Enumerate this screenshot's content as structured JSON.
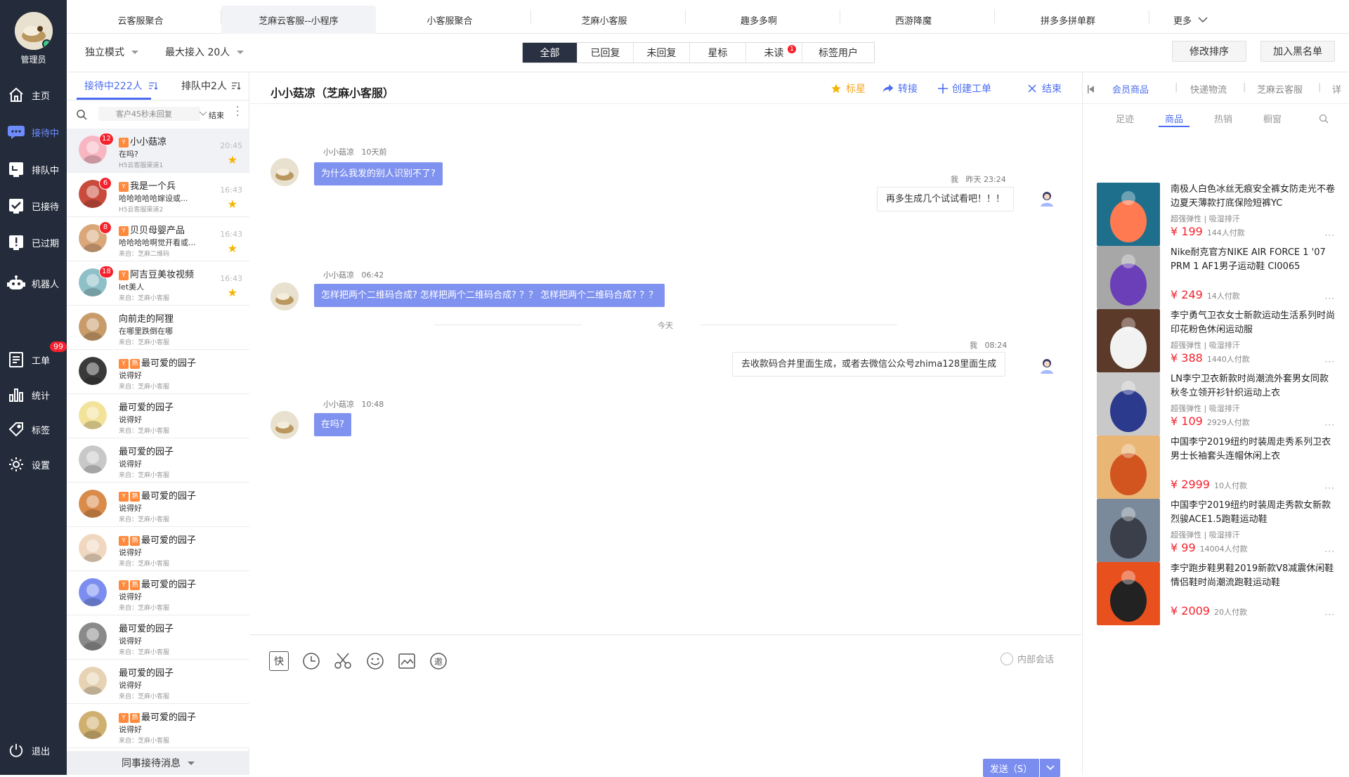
{
  "nav": {
    "role": "管理员",
    "items": [
      {
        "label": "主页",
        "icon": "home-icon"
      },
      {
        "label": "接待中",
        "icon": "chat-icon"
      },
      {
        "label": "排队中",
        "icon": "queue-icon"
      },
      {
        "label": "已接待",
        "icon": "check-icon"
      },
      {
        "label": "已过期",
        "icon": "alert-icon"
      },
      {
        "label": "机器人",
        "icon": "robot-icon"
      },
      {
        "label": "工单",
        "icon": "ticket-icon",
        "badge": "99"
      },
      {
        "label": "统计",
        "icon": "chart-icon"
      },
      {
        "label": "标签",
        "icon": "tag-icon"
      },
      {
        "label": "设置",
        "icon": "gear-icon"
      }
    ],
    "logout": "退出"
  },
  "top_tabs": [
    "云客服聚合",
    "芝麻云客服--小程序",
    "小客服聚合",
    "芝麻小客服",
    "趣多多啊",
    "西游降魔",
    "拼多多拼单群",
    "更多"
  ],
  "subbar": {
    "mode": "独立模式",
    "max_access": "最大接入 20人",
    "filters": [
      "全部",
      "已回复",
      "未回复",
      "星标",
      "未读",
      "标签用户"
    ],
    "unread_count": "1",
    "sort_button": "修改排序",
    "blacklist_button": "加入黑名单"
  },
  "list": {
    "tab_serving": "接待中222人",
    "tab_queue": "排队中2人",
    "search_placeholder": "客户45秒未回复",
    "end_label": "结束",
    "footer": "同事接待消息",
    "conversations": [
      {
        "name": "小小菇凉",
        "msg": "在吗?",
        "src": "H5云客服渠道1",
        "time": "20:45",
        "badge": "12",
        "tags": [
          "Y"
        ],
        "star": true
      },
      {
        "name": "我是一个兵",
        "msg": "哈哈哈哈哈嫁设或...",
        "src": "H5云客服渠道2",
        "time": "16:43",
        "badge": "6",
        "tags": [
          "Y"
        ],
        "star": true
      },
      {
        "name": "贝贝母婴产品",
        "msg": "哈哈哈哈啊觉开看或...",
        "src": "来自：芝麻二维码",
        "time": "16:43",
        "badge": "8",
        "tags": [
          "Y"
        ],
        "star": true
      },
      {
        "name": "阿吉豆美妆视频",
        "msg": "let美人",
        "src": "来自：芝麻小客服",
        "time": "16:43",
        "badge": "18",
        "tags": [
          "Y"
        ],
        "star": true
      },
      {
        "name": "向前走的阿狸",
        "msg": "在哪里跌倒在哪",
        "src": "来自：芝麻小客服",
        "time": "",
        "badge": "",
        "tags": [],
        "star": false
      },
      {
        "name": "最可爱的园子",
        "msg": "说得好",
        "src": "来自：芝麻小客服",
        "time": "",
        "badge": "",
        "tags": [
          "Y",
          "熟"
        ],
        "star": false
      },
      {
        "name": "最可爱的园子",
        "msg": "说得好",
        "src": "来自：芝麻小客服",
        "time": "",
        "badge": "",
        "tags": [],
        "star": false
      },
      {
        "name": "最可爱的园子",
        "msg": "说得好",
        "src": "来自：芝麻小客服",
        "time": "",
        "badge": "",
        "tags": [],
        "star": false
      },
      {
        "name": "最可爱的园子",
        "msg": "说得好",
        "src": "来自：芝麻小客服",
        "time": "",
        "badge": "",
        "tags": [
          "Y",
          "熟"
        ],
        "star": false
      },
      {
        "name": "最可爱的园子",
        "msg": "说得好",
        "src": "来自：芝麻小客服",
        "time": "",
        "badge": "",
        "tags": [
          "Y",
          "熟"
        ],
        "star": false
      },
      {
        "name": "最可爱的园子",
        "msg": "说得好",
        "src": "来自：芝麻小客服",
        "time": "",
        "badge": "",
        "tags": [
          "Y",
          "熟"
        ],
        "star": false
      },
      {
        "name": "最可爱的园子",
        "msg": "说得好",
        "src": "来自：芝麻小客服",
        "time": "",
        "badge": "",
        "tags": [],
        "star": false
      },
      {
        "name": "最可爱的园子",
        "msg": "说得好",
        "src": "来自：芝麻小客服",
        "time": "",
        "badge": "",
        "tags": [],
        "star": false
      },
      {
        "name": "最可爱的园子",
        "msg": "说得好",
        "src": "来自：芝麻小客服",
        "time": "",
        "badge": "",
        "tags": [
          "Y",
          "熟"
        ],
        "star": false
      }
    ]
  },
  "chat": {
    "title": "小小菇凉（芝麻小客服）",
    "actions": {
      "star": "标星",
      "transfer": "转接",
      "create_ticket": "创建工单",
      "end": "结束"
    },
    "messages": [
      {
        "side": "left",
        "sender": "小小菇凉",
        "time": "10天前",
        "text": "为什么我发的别人识别不了?"
      },
      {
        "side": "right",
        "sender": "我",
        "time": "昨天 23:24",
        "text": "再多生成几个试试看吧！！！"
      },
      {
        "side": "left",
        "sender": "小小菇凉",
        "time": "06:42",
        "text": "怎样把两个二维码合成? 怎样把两个二维码合成? ？？ 怎样把两个二维码合成? ？？"
      },
      {
        "side": "right",
        "sender": "我",
        "time": "08:24",
        "text": "去收款码合并里面生成，或者去微信公众号zhima128里面生成"
      },
      {
        "side": "left",
        "sender": "小小菇凉",
        "time": "10:48",
        "text": "在吗?"
      }
    ],
    "divider": "今天",
    "tools": {
      "quick": "快"
    },
    "internal": "内部会话",
    "send": "发送（S）"
  },
  "right": {
    "tabs": [
      "会员商品",
      "快递物流",
      "芝麻云客服",
      "详"
    ],
    "subtabs": [
      "足迹",
      "商品",
      "热销",
      "橱窗"
    ],
    "products": [
      {
        "title": "南极人白色冰丝无痕安全裤女防走光不卷边夏天薄款打底保险短裤YC",
        "tag": "超强弹性 | 吸湿排汗",
        "price": "¥ 199",
        "paid": "144人付款"
      },
      {
        "title": "Nike耐克官方NIKE AIR FORCE 1 '07 PRM 1 AF1男子运动鞋 CI0065",
        "tag": "",
        "price": "¥ 249",
        "paid": "14人付款"
      },
      {
        "title": "李宁勇气卫衣女士新款运动生活系列时尚印花粉色休闲运动服",
        "tag": "超强弹性 | 吸湿排汗",
        "price": "¥ 388",
        "paid": "1440人付款"
      },
      {
        "title": "LN李宁卫衣新款时尚潮流外套男女同款秋冬立领开衫针织运动上衣",
        "tag": "超强弹性 | 吸湿排汗",
        "price": "¥ 109",
        "paid": "2929人付款"
      },
      {
        "title": "中国李宁2019纽约时装周走秀系列卫衣男士长袖套头连帽休闲上衣",
        "tag": "",
        "price": "¥ 2999",
        "paid": "10人付款"
      },
      {
        "title": "中国李宁2019纽约时装周走秀款女新款烈骏ACE1.5跑鞋运动鞋",
        "tag": "超强弹性 | 吸湿排汗",
        "price": "¥ 99",
        "paid": "14004人付款"
      },
      {
        "title": "李宁跑步鞋男鞋2019新款V8减震休闲鞋情侣鞋时尚潮流跑鞋运动鞋",
        "tag": "",
        "price": "¥ 2009",
        "paid": "20人付款"
      }
    ]
  },
  "colors": {
    "accent": "#4b6cf0",
    "bubble": "#7f92f0",
    "nav_bg": "#242c3c",
    "price": "#f5222d",
    "star": "#f5b400"
  }
}
